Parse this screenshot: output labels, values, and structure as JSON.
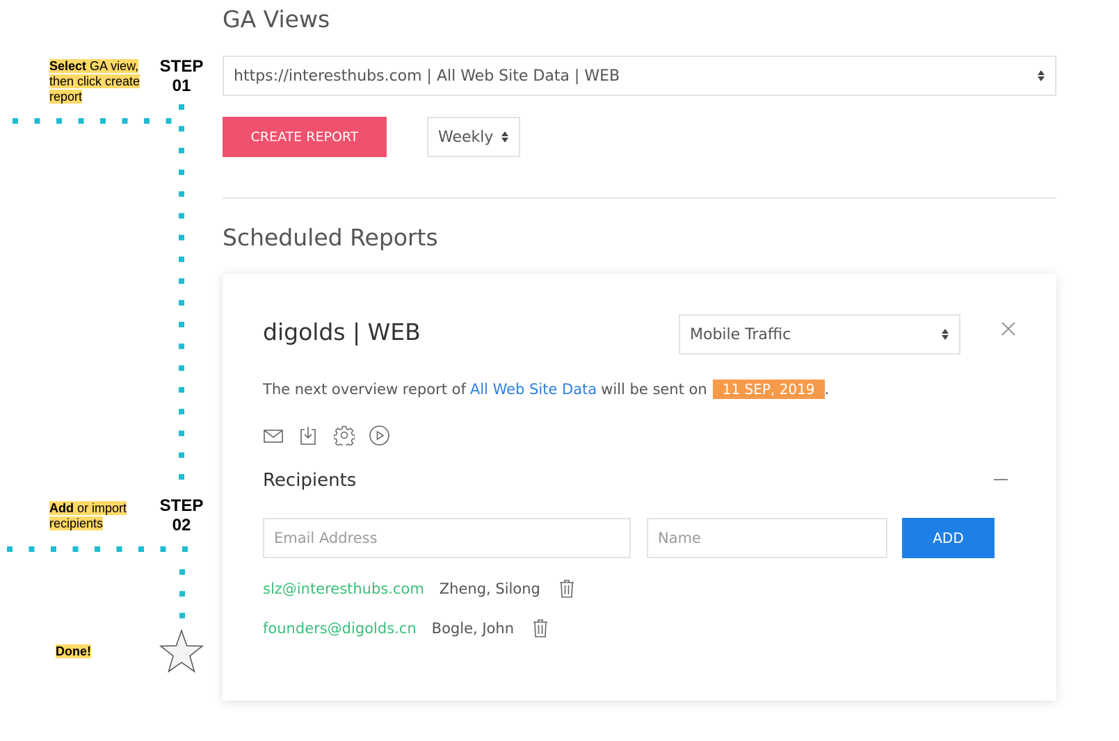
{
  "annotations": {
    "step1": {
      "label": "STEP",
      "number": "01",
      "note_bold": "Select",
      "note_rest": " GA view, then click create report"
    },
    "step2": {
      "label": "STEP",
      "number": "02",
      "note_bold": "Add",
      "note_rest": " or import recipients"
    },
    "done": {
      "label": "Done!",
      "icon": "star-icon"
    },
    "dot_color": "#1fbcd2",
    "highlight_color": "#ffd966"
  },
  "ga_views": {
    "title": "GA Views",
    "selected_view": "https://interesthubs.com | All Web Site Data | WEB",
    "create_button": "CREATE REPORT",
    "frequency": "Weekly",
    "accent": "#f0516e"
  },
  "scheduled": {
    "title": "Scheduled Reports",
    "card": {
      "title": "digolds | WEB",
      "report_type": "Mobile Traffic",
      "sentence_prefix": "The next overview report of",
      "view_link": "All Web Site Data",
      "sentence_middle": "will be sent on",
      "date": "11 SEP, 2019",
      "sentence_end": ".",
      "action_icons": [
        "mail-icon",
        "download-icon",
        "gear-icon",
        "play-icon"
      ],
      "recipients_title": "Recipients",
      "email_placeholder": "Email Address",
      "name_placeholder": "Name",
      "add_button": "ADD",
      "recipients": [
        {
          "email": "slz@interesthubs.com",
          "name": "Zheng, Silong"
        },
        {
          "email": "founders@digolds.cn",
          "name": "Bogle, John"
        }
      ],
      "colors": {
        "link": "#2e7fe3",
        "date_badge": "#f79a4a",
        "email": "#3bbf7a",
        "add_button": "#1e7fe6"
      }
    }
  }
}
